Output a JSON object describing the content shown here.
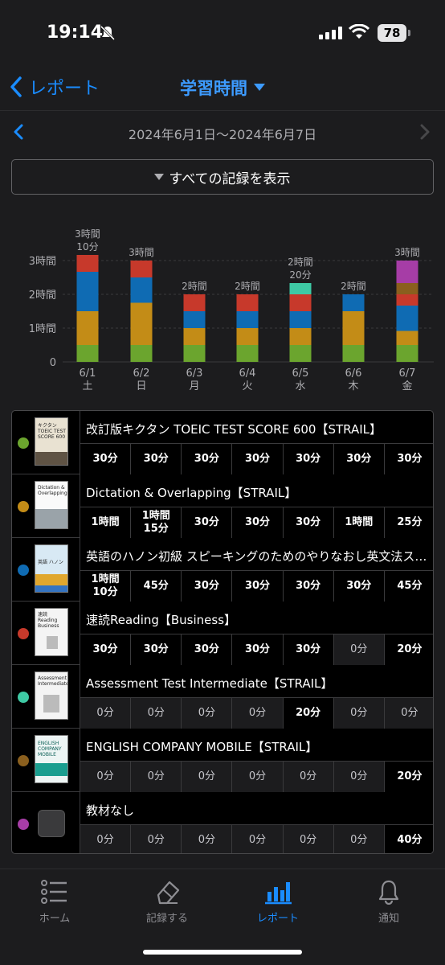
{
  "status_bar": {
    "time": "19:14",
    "battery": "78"
  },
  "nav": {
    "back_label": "レポート",
    "title": "学習時間"
  },
  "date_range": {
    "label": "2024年6月1日〜2024年6月7日"
  },
  "filter": {
    "label": "すべての記録を表示"
  },
  "colors": {
    "book1": "#6ba52e",
    "book2": "#c38c17",
    "book3": "#0f6bb3",
    "book4": "#c7392b",
    "book5": "#3ec9a4",
    "book6": "#8a5f1e",
    "book7": "#a63da6",
    "accent": "#1a8cff"
  },
  "chart_data": {
    "type": "bar",
    "stacked": true,
    "categories": [
      "6/1 土",
      "6/2 日",
      "6/3 月",
      "6/4 火",
      "6/5 水",
      "6/6 木",
      "6/7 金"
    ],
    "x_labels": [
      [
        "6/1",
        "土"
      ],
      [
        "6/2",
        "日"
      ],
      [
        "6/3",
        "月"
      ],
      [
        "6/4",
        "火"
      ],
      [
        "6/5",
        "水"
      ],
      [
        "6/6",
        "木"
      ],
      [
        "6/7",
        "金"
      ]
    ],
    "y_ticks": [
      "0",
      "1時間",
      "2時間",
      "3時間"
    ],
    "ylim_minutes": [
      0,
      180
    ],
    "totals_labels": [
      [
        "3時間",
        "10分"
      ],
      [
        "3時間"
      ],
      [
        "2時間"
      ],
      [
        "2時間"
      ],
      [
        "2時間",
        "20分"
      ],
      [
        "2時間"
      ],
      [
        "3時間"
      ]
    ],
    "series": [
      {
        "color": "#6ba52e",
        "values": [
          30,
          30,
          30,
          30,
          30,
          30,
          30
        ]
      },
      {
        "color": "#c38c17",
        "values": [
          60,
          75,
          30,
          30,
          30,
          60,
          25
        ]
      },
      {
        "color": "#0f6bb3",
        "values": [
          70,
          45,
          30,
          30,
          30,
          30,
          45
        ]
      },
      {
        "color": "#c7392b",
        "values": [
          30,
          30,
          30,
          30,
          30,
          0,
          20
        ]
      },
      {
        "color": "#3ec9a4",
        "values": [
          0,
          0,
          0,
          0,
          20,
          0,
          0
        ]
      },
      {
        "color": "#8a5f1e",
        "values": [
          0,
          0,
          0,
          0,
          0,
          0,
          20
        ]
      },
      {
        "color": "#a63da6",
        "values": [
          0,
          0,
          0,
          0,
          0,
          0,
          40
        ]
      }
    ]
  },
  "books": [
    {
      "title": "改訂版キクタン TOEIC TEST SCORE 600【STRAIL】",
      "color": "#6ba52e",
      "thumb": "kikutan",
      "cells": [
        "30分",
        "30分",
        "30分",
        "30分",
        "30分",
        "30分",
        "30分"
      ],
      "zero": [
        false,
        false,
        false,
        false,
        false,
        false,
        false
      ]
    },
    {
      "title": "Dictation & Overlapping【STRAIL】",
      "color": "#c38c17",
      "thumb": "dictation",
      "cells": [
        "1時間",
        "1時間\n15分",
        "30分",
        "30分",
        "30分",
        "1時間",
        "25分"
      ],
      "zero": [
        false,
        false,
        false,
        false,
        false,
        false,
        false
      ]
    },
    {
      "title": "英語のハノン初級 スピーキングのためのやりなおし英文法スーパードリル",
      "color": "#0f6bb3",
      "thumb": "hanon",
      "cells": [
        "1時間\n10分",
        "45分",
        "30分",
        "30分",
        "30分",
        "30分",
        "45分"
      ],
      "zero": [
        false,
        false,
        false,
        false,
        false,
        false,
        false
      ]
    },
    {
      "title": "速読Reading【Business】",
      "color": "#c7392b",
      "thumb": "reading",
      "cells": [
        "30分",
        "30分",
        "30分",
        "30分",
        "30分",
        "0分",
        "20分"
      ],
      "zero": [
        false,
        false,
        false,
        false,
        false,
        true,
        false
      ]
    },
    {
      "title": "Assessment Test Intermediate【STRAIL】",
      "color": "#3ec9a4",
      "thumb": "assessment",
      "cells": [
        "0分",
        "0分",
        "0分",
        "0分",
        "20分",
        "0分",
        "0分"
      ],
      "zero": [
        true,
        true,
        true,
        true,
        false,
        true,
        true
      ]
    },
    {
      "title": "ENGLISH COMPANY MOBILE【STRAIL】",
      "color": "#8a5f1e",
      "thumb": "mobile",
      "cells": [
        "0分",
        "0分",
        "0分",
        "0分",
        "0分",
        "0分",
        "20分"
      ],
      "zero": [
        true,
        true,
        true,
        true,
        true,
        true,
        false
      ]
    },
    {
      "title": "教材なし",
      "color": "#a63da6",
      "thumb": "none",
      "cells": [
        "0分",
        "0分",
        "0分",
        "0分",
        "0分",
        "0分",
        "40分"
      ],
      "zero": [
        true,
        true,
        true,
        true,
        true,
        true,
        false
      ]
    }
  ],
  "thumb_text": {
    "kikutan": "キクタン TOEIC TEST SCORE 600",
    "dictation": "Dictation & Overlapping",
    "hanon": "英語 ハノン",
    "reading": "速読 Reading Business",
    "assessment": "Assessment Intermediate",
    "mobile": "ENGLISH COMPANY MOBILE"
  },
  "tabs": [
    {
      "label": "ホーム",
      "icon": "list-icon"
    },
    {
      "label": "記録する",
      "icon": "eraser-icon"
    },
    {
      "label": "レポート",
      "icon": "bar-chart-icon",
      "active": true
    },
    {
      "label": "通知",
      "icon": "bell-icon"
    }
  ]
}
